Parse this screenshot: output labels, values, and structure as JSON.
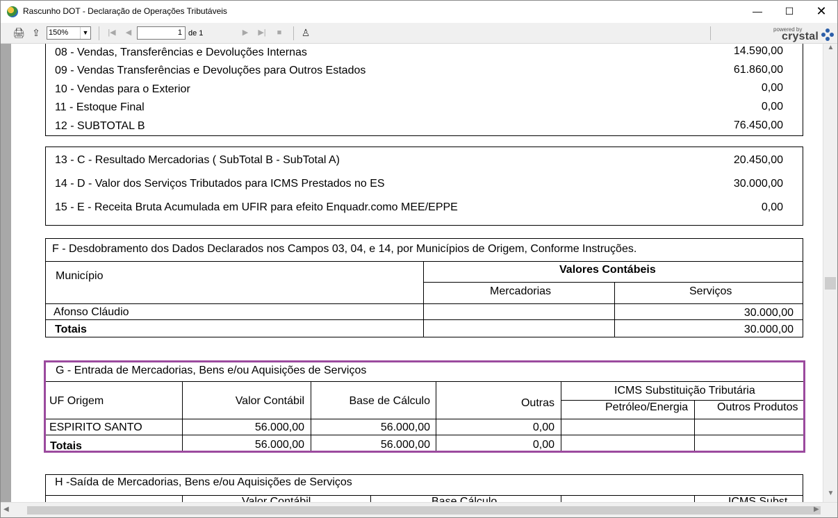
{
  "window": {
    "title": "Rascunho DOT - Declaração de Operações Tributáveis",
    "controls": {
      "minimize": "—",
      "maximize": "☐",
      "close": "✕"
    }
  },
  "toolbar": {
    "zoom": "150%",
    "page": "1",
    "page_of": "de 1",
    "logo_small": "powered by",
    "logo_text": "crystal"
  },
  "section_b": {
    "rows": [
      {
        "label": "08 - Vendas, Transferências e Devoluções Internas",
        "value": "14.590,00"
      },
      {
        "label": "09 - Vendas Transferências e Devoluções para Outros Estados",
        "value": "61.860,00"
      },
      {
        "label": "10 - Vendas para o Exterior",
        "value": "0,00"
      },
      {
        "label": "11 - Estoque Final",
        "value": "0,00"
      },
      {
        "label": "12 - SUBTOTAL B",
        "value": "76.450,00"
      }
    ]
  },
  "section_c": {
    "rows": [
      {
        "label": "13 - C - Resultado Mercadorias ( SubTotal B - SubTotal A)",
        "value": "20.450,00"
      },
      {
        "label": "14 - D - Valor dos Serviços Tributados para ICMS Prestados no ES",
        "value": "30.000,00"
      },
      {
        "label": "15 - E - Receita Bruta Acumulada em UFIR para efeito Enquadr.como MEE/EPPE",
        "value": "0,00"
      }
    ]
  },
  "section_f": {
    "title": "F - Desdobramento dos Dados Declarados nos Campos 03, 04, e 14, por Municípios de Origem, Conforme Instruções.",
    "municipio_header": "Município",
    "values_header": "Valores Contábeis",
    "mercadorias_header": "Mercadorias",
    "servicos_header": "Serviços",
    "rows": [
      {
        "municipio": "Afonso Cláudio",
        "mercadorias": "",
        "servicos": "30.000,00"
      }
    ],
    "totals": {
      "label": "Totais",
      "mercadorias": "",
      "servicos": "30.000,00"
    }
  },
  "section_g": {
    "title": "G - Entrada de Mercadorias, Bens e/ou Aquisições de Serviços",
    "headers": {
      "uf": "UF Origem",
      "valor": "Valor Contábil",
      "base": "Base de Cálculo",
      "outras": "Outras",
      "icms": "ICMS Substituição Tributária",
      "petroleo": "Petróleo/Energia",
      "outros": "Outros Produtos"
    },
    "rows": [
      {
        "uf": "ESPIRITO SANTO",
        "valor": "56.000,00",
        "base": "56.000,00",
        "outras": "0,00",
        "petroleo": "",
        "outros": ""
      }
    ],
    "totals": {
      "label": "Totais",
      "valor": "56.000,00",
      "base": "56.000,00",
      "outras": "0,00"
    }
  },
  "section_h": {
    "title": "H -Saída de Mercadorias, Bens e/ou Aquisições de Serviços",
    "headers": {
      "valor": "Valor Contábil",
      "base": "Base Cálculo",
      "icms": "ICMS Subst"
    }
  }
}
